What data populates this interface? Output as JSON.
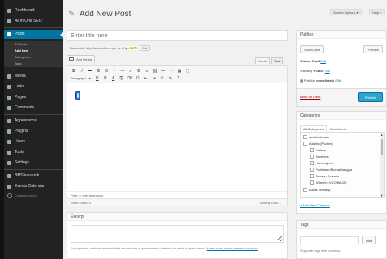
{
  "sidebar": {
    "items": [
      {
        "label": "Dashboard"
      },
      {
        "label": "All in One SEO"
      },
      {
        "label": "Posts"
      },
      {
        "label": "Media"
      },
      {
        "label": "Links"
      },
      {
        "label": "Pages"
      },
      {
        "label": "Comments"
      },
      {
        "label": "Appearance"
      },
      {
        "label": "Plugins"
      },
      {
        "label": "Users"
      },
      {
        "label": "Tools"
      },
      {
        "label": "Settings"
      },
      {
        "label": "BMSlivestook"
      },
      {
        "label": "Events Calendar"
      }
    ],
    "posts_sub": [
      "All Posts",
      "Add New",
      "Categories",
      "Tags"
    ],
    "collapse_label": "Collapse menu"
  },
  "header": {
    "title": "Add New Post",
    "screen_options": "Screen Options ▾",
    "help": "Help ▾"
  },
  "editor": {
    "title_placeholder": "Enter title here",
    "permalink_prefix": "Permalink: http://ancient-bar.vps.az.d/",
    "permalink_slug": "?p=3622",
    "edit_label": "Edit",
    "add_media": "Add Media",
    "tab_visual": "Visual",
    "tab_text": "Text",
    "format_select": "Paragraph",
    "path": "Path: p » div.alignnone",
    "word_count": "Word count: 0",
    "saved_status": "Saving Draft..."
  },
  "excerpt": {
    "title": "Excerpt",
    "help": "Excerpts are optional hand-crafted summaries of your content that can be used in your theme.",
    "help_link": "Learn more about manual excerpts."
  },
  "publish": {
    "title": "Publish",
    "save_draft": "Save Draft",
    "preview": "Preview",
    "status_label": "Status:",
    "status_value": "Draft",
    "visibility_label": "Visibility:",
    "visibility_value": "Public",
    "schedule_label": "Publish",
    "schedule_value": "immediately",
    "edit": "Edit",
    "trash": "Move to Trash",
    "publish_btn": "Publish"
  },
  "categories": {
    "title": "Categories",
    "tab_all": "All Categories",
    "tab_used": "Most Used",
    "items": [
      {
        "label": "andre's home",
        "indent": 0
      },
      {
        "label": "Atlantic (Parlors)",
        "indent": 0
      },
      {
        "label": "Gallery",
        "indent": 1
      },
      {
        "label": "Bakeries",
        "indent": 1
      },
      {
        "label": "Homestyles",
        "indent": 1
      },
      {
        "label": "Publiware/Biomailsangga",
        "indent": 1
      },
      {
        "label": "Tonwyn Sowsca",
        "indent": 1
      },
      {
        "label": "Wheelin (VCOMADE)",
        "indent": 1
      },
      {
        "label": "Banta Teribasy",
        "indent": 0
      }
    ],
    "add_new": "+ Add New Category"
  },
  "tags": {
    "title": "Tags",
    "add": "Add",
    "help": "Separate tags with commas"
  }
}
